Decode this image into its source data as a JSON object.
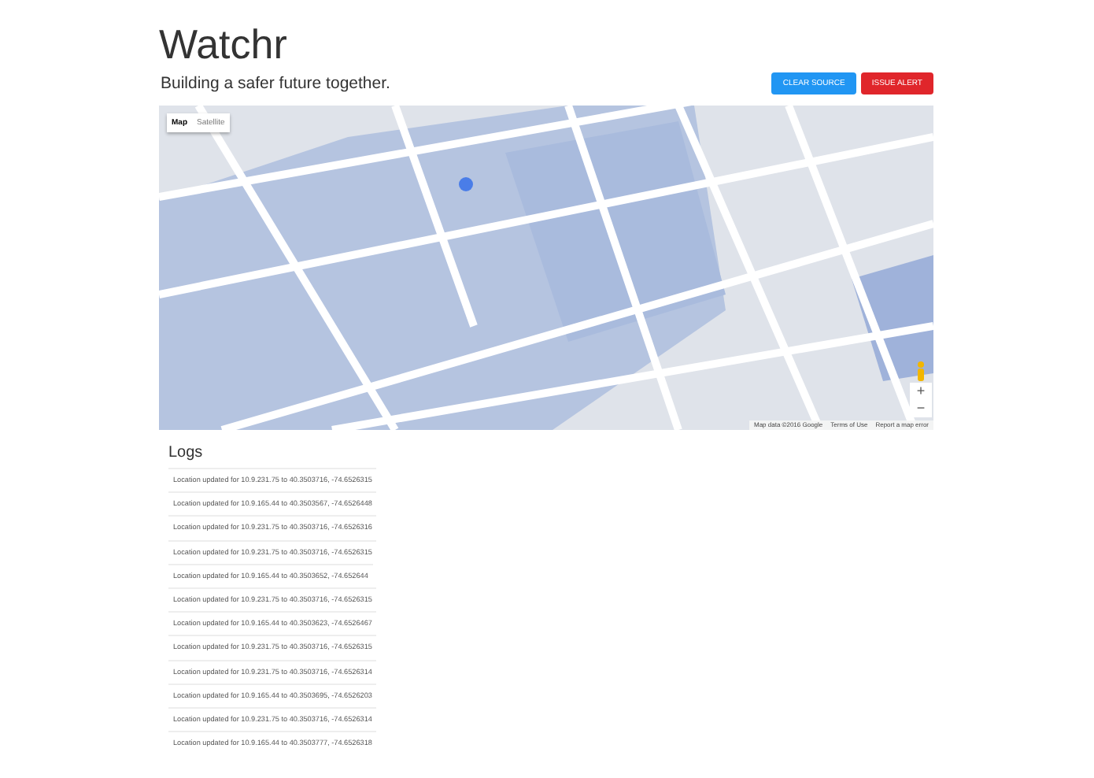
{
  "header": {
    "title": "Watchr",
    "subtitle": "Building a safer future together."
  },
  "buttons": [
    {
      "label": "CLEAR SOURCE",
      "kind": "primary"
    },
    {
      "label": "ISSUE ALERT",
      "kind": "danger"
    }
  ],
  "map": {
    "type_tabs": [
      {
        "label": "Map",
        "selected": true
      },
      {
        "label": "Satellite",
        "selected": false
      }
    ],
    "zoom_in": "+",
    "zoom_out": "−",
    "attribution": [
      "Map data ©2016 Google",
      "Terms of Use",
      "Report a map error"
    ]
  },
  "logs": {
    "title": "Logs",
    "entries": [
      "Location updated for 10.9.231.75 to 40.3503716, -74.6526315",
      "Location updated for 10.9.165.44 to 40.3503567, -74.6526448",
      "Location updated for 10.9.231.75 to 40.3503716, -74.6526316",
      "Location updated for 10.9.231.75 to 40.3503716, -74.6526315",
      "Location updated for 10.9.165.44 to 40.3503652, -74.652644",
      "Location updated for 10.9.231.75 to 40.3503716, -74.6526315",
      "Location updated for 10.9.165.44 to 40.3503623, -74.6526467",
      "Location updated for 10.9.231.75 to 40.3503716, -74.6526315",
      "Location updated for 10.9.231.75 to 40.3503716, -74.6526314",
      "Location updated for 10.9.165.44 to 40.3503695, -74.6526203",
      "Location updated for 10.9.231.75 to 40.3503716, -74.6526314",
      "Location updated for 10.9.165.44 to 40.3503777, -74.6526318"
    ]
  }
}
